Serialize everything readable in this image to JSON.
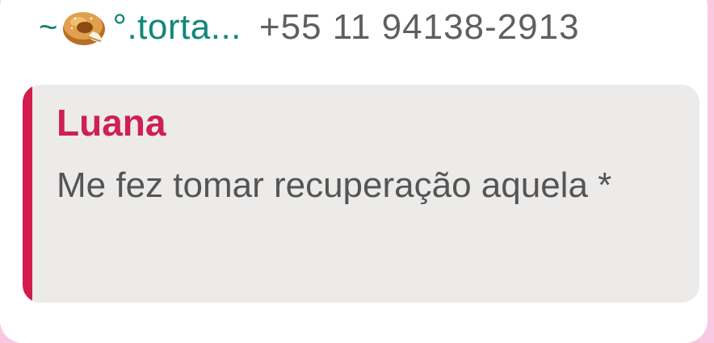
{
  "reply_header": {
    "tilde": "~",
    "sender_name": "°.torta...",
    "sender_phone": "+55 11 94138-2913"
  },
  "quoted_message": {
    "author": "Luana",
    "text": "Me fez tomar recuperação aquela *",
    "accent_color": "#d11c4c"
  },
  "icons": {
    "sender_emoji": "bagel-emoji-icon"
  }
}
